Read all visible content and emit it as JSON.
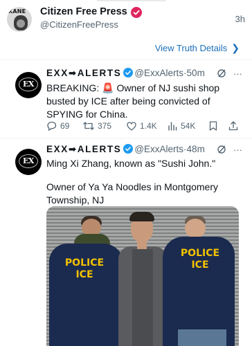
{
  "post": {
    "account_name": "Citizen Free Press",
    "account_handle": "@CitizenFreePress",
    "time": "3h",
    "avatar_text": "KANE",
    "view_details_label": "View Truth Details"
  },
  "tweets": [
    {
      "name": "EXX➡ALERTS",
      "handle": "@ExxAlerts",
      "separator": "·",
      "time": "50m",
      "avatar_text": "EX",
      "body": "BREAKING: 🚨  Owner of NJ sushi shop busted by ICE after being convicted of SPYING for China.",
      "replies": "69",
      "retweets": "375",
      "likes": "1.4K",
      "views": "54K"
    },
    {
      "name": "EXX➡ALERTS",
      "handle": "@ExxAlerts",
      "separator": "·",
      "time": "48m",
      "avatar_text": "EX",
      "body_line1": "Ming Xi Zhang, known as \"Sushi John.\"",
      "body_line2": "Owner of Ya Ya Noodles in Montgomery Township, NJ",
      "photo_text_left": "POLICE\nICE",
      "photo_text_right": "POLICE\nICE"
    }
  ],
  "colors": {
    "link": "#1d6fb8",
    "verified": "#1d9bf0",
    "truth_badge": "#e0245e",
    "muted": "#536471"
  },
  "icons": [
    "verified-badge-icon",
    "chevron-right-icon",
    "grok-icon",
    "more-icon",
    "reply-icon",
    "retweet-icon",
    "like-icon",
    "views-icon",
    "bookmark-icon",
    "share-icon"
  ]
}
